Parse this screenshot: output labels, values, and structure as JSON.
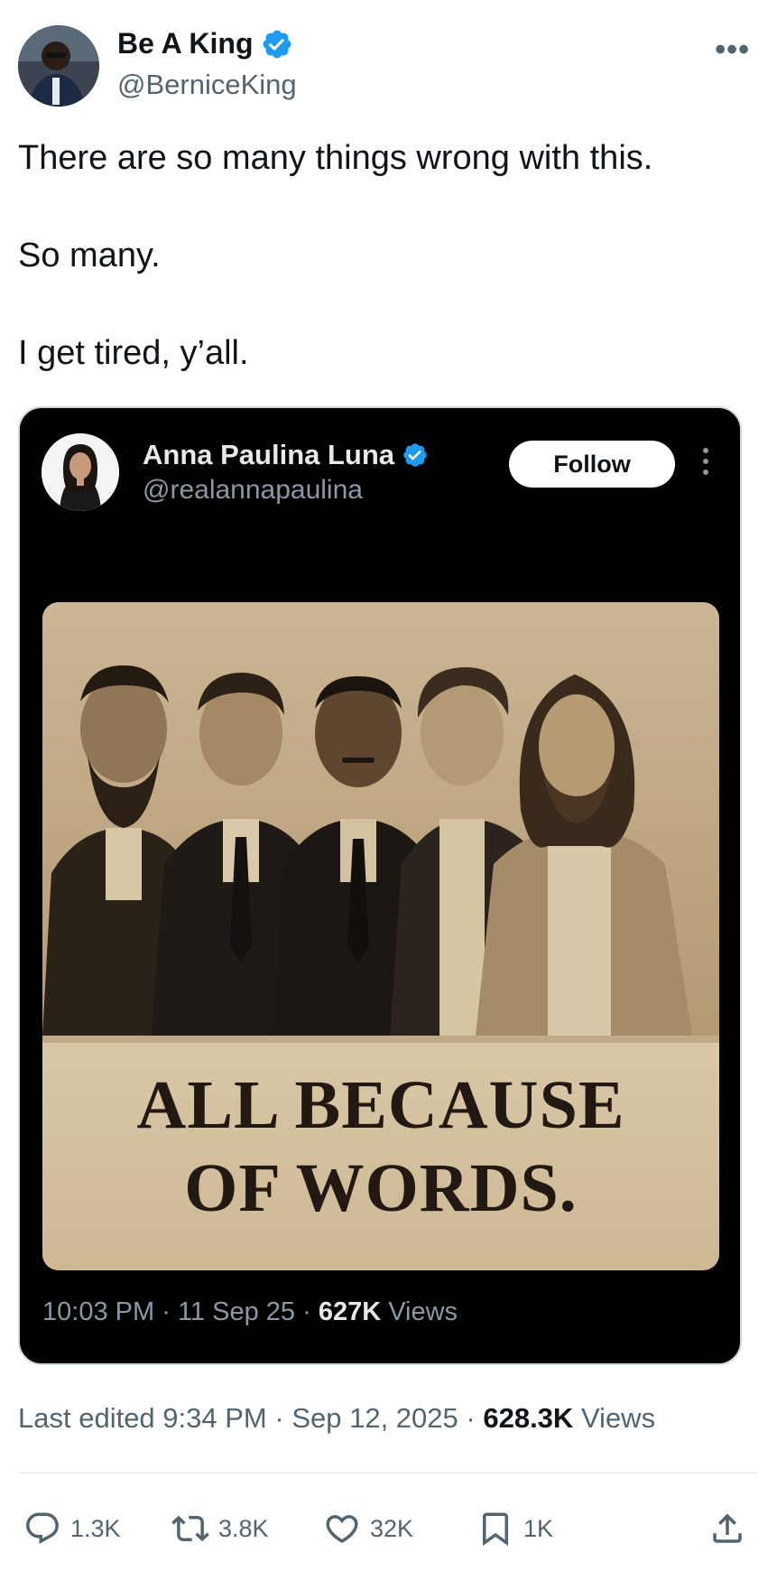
{
  "author": {
    "name": "Be A King",
    "handle": "@BerniceKing"
  },
  "menu": {
    "more_label": "•••"
  },
  "tweet_text": {
    "line1": "There are so many things wrong with this.",
    "line2": "So many.",
    "line3": "I get tired, y’all."
  },
  "quoted": {
    "name": "Anna Paulina Luna",
    "handle": "@realannapaulina",
    "follow_label": "Follow",
    "image_caption": {
      "line1": "ALL BECAUSE",
      "line2": "OF WORDS."
    },
    "time": "10:03 PM",
    "date": "11 Sep 25",
    "views_count": "627K",
    "views_label": "Views",
    "sep": "·"
  },
  "edited": {
    "prefix": "Last edited 9:34 PM",
    "date": "Sep 12, 2025",
    "views_count": "628.3K",
    "views_label": "Views",
    "sep": "·"
  },
  "actions": {
    "replies": "1.3K",
    "reposts": "3.8K",
    "likes": "32K",
    "bookmarks": "1K"
  },
  "colors": {
    "verified": "#1d9bf0",
    "text": "#0f1419",
    "muted": "#536471",
    "quote_bg": "#000000"
  }
}
